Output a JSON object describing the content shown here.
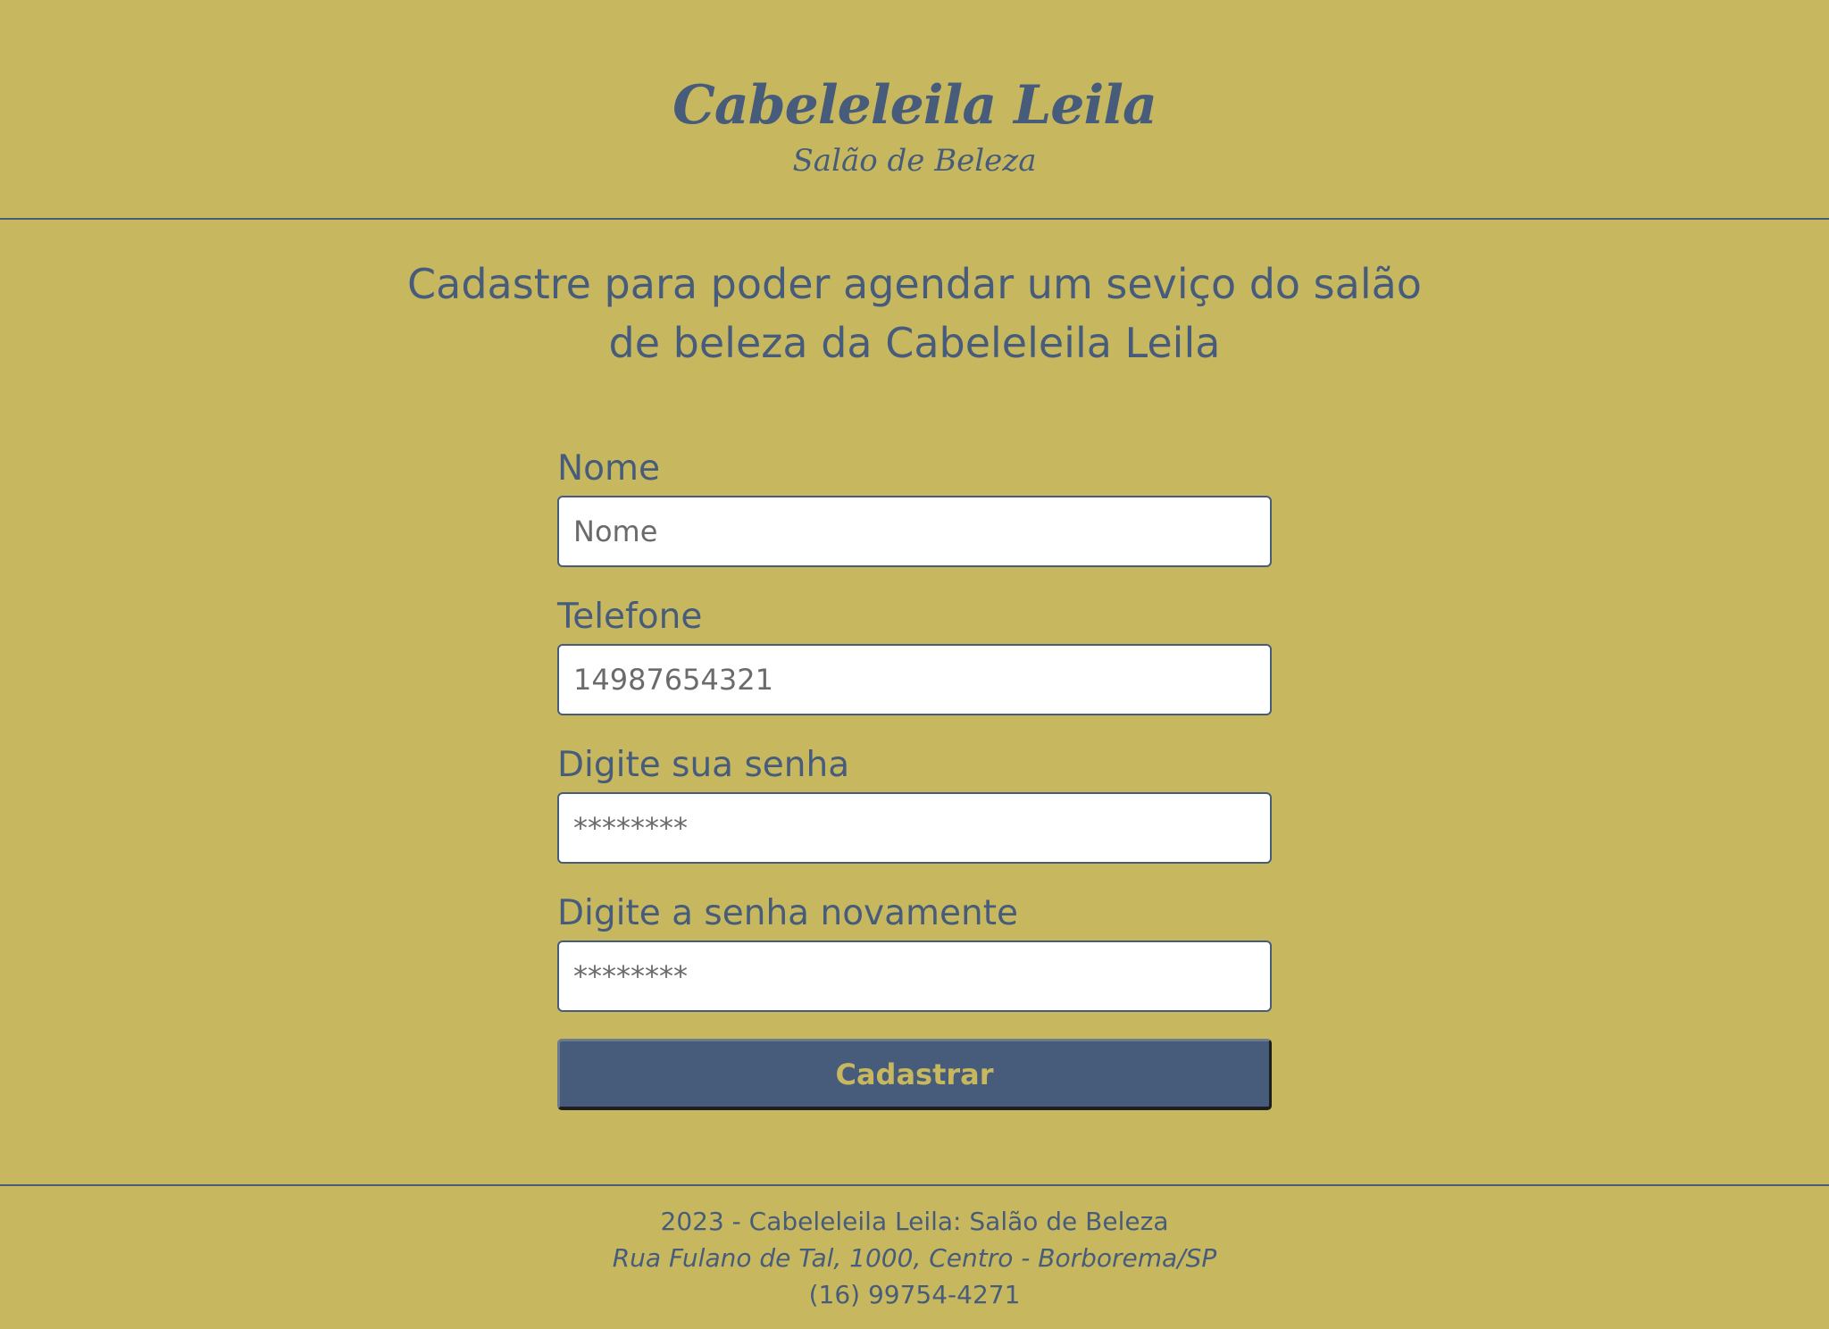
{
  "header": {
    "brand_title": "Cabeleleila Leila",
    "brand_subtitle": "Salão de Beleza"
  },
  "intro": {
    "line1": "Cadastre para poder agendar um seviço do salão",
    "line2": "de beleza da Cabeleleila Leila"
  },
  "form": {
    "fields": [
      {
        "label": "Nome",
        "placeholder": "Nome",
        "value": ""
      },
      {
        "label": "Telefone",
        "placeholder": "",
        "value": "14987654321"
      },
      {
        "label": "Digite sua senha",
        "placeholder": "********",
        "value": ""
      },
      {
        "label": "Digite a senha novamente",
        "placeholder": "********",
        "value": ""
      }
    ],
    "submit_label": "Cadastrar"
  },
  "footer": {
    "copyright": "2023 - Cabeleleila Leila: Salão de Beleza",
    "address": "Rua Fulano de Tal, 1000, Centro - Borborema/SP",
    "phone": "(16) 99754-4271"
  },
  "colors": {
    "background": "#c7b85f",
    "primary": "#475c7a",
    "input_background": "#ffffff"
  }
}
